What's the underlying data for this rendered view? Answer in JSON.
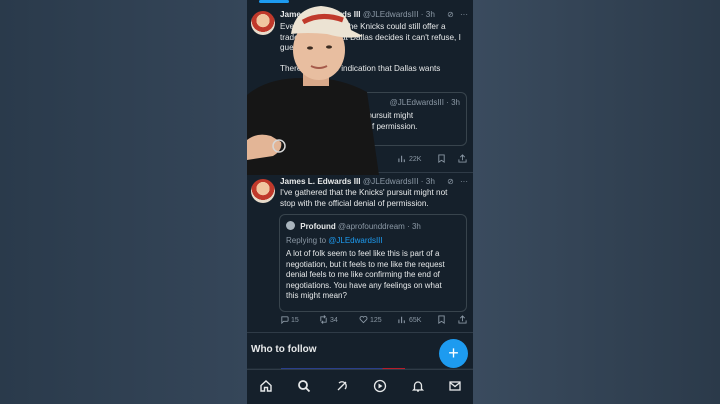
{
  "tweet1": {
    "name": "James L. Edwards III",
    "handle": "@JLEdwardsIII",
    "time": "3h",
    "text_lines": [
      "Even with all that, the Knicks could still offer a",
      "trade package that Dallas decides it can't refuse, I",
      "guess."
    ],
    "text2": "There's been no indication that Dallas wants",
    "quote_handle": "@JLEdwardsIII · 3h",
    "quote_lines": [
      "Knicks' pursuit might",
      "l denial of permission.",
      "..."
    ],
    "views": "22K"
  },
  "tweet2": {
    "name": "James L. Edwards III",
    "handle": "@JLEdwardsIII",
    "time": "3h",
    "text_lines": [
      "I've gathered that the Knicks' pursuit might not",
      "stop with the official denial of permission."
    ],
    "quote": {
      "name": "Profound",
      "handle": "@aprofounddream",
      "time": "3h",
      "replying_label": "Replying to",
      "replying_handle": "@JLEdwardsIII",
      "text_lines": [
        "A lot of folk seem to feel like this is part of a",
        "negotiation, but it feels to me like the request",
        "denial feels to me like confirming the end of",
        "negotiations. You have any feelings on what",
        "this might mean?"
      ]
    },
    "replies": "15",
    "reposts": "34",
    "likes": "125",
    "views": "65K"
  },
  "who_to_follow": "Who to follow",
  "fab_label": "+",
  "colors": {
    "accent": "#1d9bf0",
    "background": "#15202b",
    "muted": "#8b98a5"
  },
  "nav_icons": [
    "home-icon",
    "search-icon",
    "grok-icon",
    "play-icon",
    "bell-icon",
    "mail-icon"
  ]
}
